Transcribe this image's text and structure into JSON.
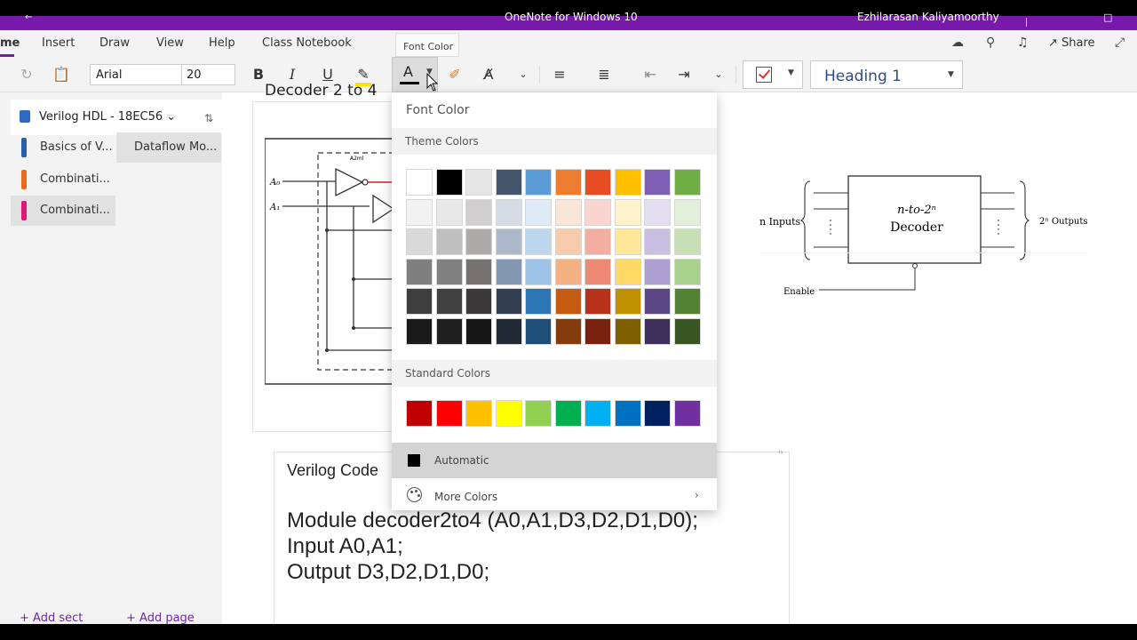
{
  "titlebar": {
    "app_title": "OneNote for Windows 10",
    "user_name": "Ezhilarasan Kaliyamoorthy"
  },
  "menu": {
    "tabs": [
      {
        "label": "me",
        "active": true
      },
      {
        "label": "Insert"
      },
      {
        "label": "Draw"
      },
      {
        "label": "View"
      },
      {
        "label": "Help"
      },
      {
        "label": "Class Notebook"
      }
    ],
    "tooltip": "Font Color",
    "share_label": "Share"
  },
  "ribbon": {
    "font_name": "Arial",
    "font_size": "20",
    "font_color_letter": "A",
    "bold": "B",
    "italic": "I",
    "underline": "U",
    "style": "Heading 1"
  },
  "nav": {
    "notebook_title": "Verilog HDL - 18EC56",
    "sections": [
      {
        "label": "Basics of V...",
        "color": "#2b5fae"
      },
      {
        "label": "Combinati...",
        "color": "#ea6a1f"
      },
      {
        "label": "Combinati...",
        "color": "#d81b77",
        "selected": true
      }
    ],
    "selected_page": "Dataflow Mo...",
    "add_section": "Add sect",
    "add_page": "Add page"
  },
  "page": {
    "heading_partial": "Decoder 2 to 4",
    "circuit_labels": {
      "a0": "A₀",
      "a1": "A₁",
      "and": "A2ml"
    },
    "decoder": {
      "box_line1": "n-to-2ⁿ",
      "box_line2": "Decoder",
      "inputs_label": "n Inputs",
      "outputs_label": "2ⁿ Outputs",
      "enable_label": "Enable"
    },
    "code": {
      "title": "Verilog Code",
      "lines": [
        "Module decoder2to4 (A0,A1,D3,D2,D1,D0);",
        "Input A0,A1;",
        "Output D3,D2,D1,D0;"
      ]
    }
  },
  "dropdown": {
    "header": "Font Color",
    "theme_label": "Theme Colors",
    "standard_label": "Standard Colors",
    "automatic_label": "Automatic",
    "more_colors_label": "More Colors",
    "theme_colors": [
      [
        "#ffffff",
        "#000000",
        "#e7e6e6",
        "#44546a",
        "#5b9bd5",
        "#ed7d31",
        "#e84c22",
        "#ffc000",
        "#7f5fb3",
        "#70ad47"
      ],
      [
        "#f2f2f2",
        "#e8e8e8",
        "#d0cece",
        "#d6dce5",
        "#deebf7",
        "#fbe5d6",
        "#fad5cf",
        "#fff2cc",
        "#e4dff0",
        "#e2efda"
      ],
      [
        "#d9d9d9",
        "#bfbfbf",
        "#aeaaaa",
        "#adb9ca",
        "#bdd7ee",
        "#f8cbad",
        "#f4aea0",
        "#ffe699",
        "#c9bfe0",
        "#c5e0b4"
      ],
      [
        "#7f7f7f",
        "#808080",
        "#767171",
        "#8497b0",
        "#9dc3e6",
        "#f4b183",
        "#ee8a74",
        "#ffd966",
        "#ae9fd1",
        "#a9d18e"
      ],
      [
        "#3f3f3f",
        "#404040",
        "#3a3838",
        "#333f50",
        "#2e75b6",
        "#c55a11",
        "#b8321b",
        "#bf9000",
        "#5c4786",
        "#548235"
      ],
      [
        "#1a1a1a",
        "#1f1f1f",
        "#181717",
        "#222a35",
        "#1f4e79",
        "#843c0c",
        "#7a210f",
        "#7f6000",
        "#3d2f59",
        "#375623"
      ]
    ],
    "standard_colors": [
      "#c00000",
      "#ff0000",
      "#ffc000",
      "#ffff00",
      "#92d050",
      "#00b050",
      "#00b0f0",
      "#0070c0",
      "#002060",
      "#7030a0"
    ]
  }
}
